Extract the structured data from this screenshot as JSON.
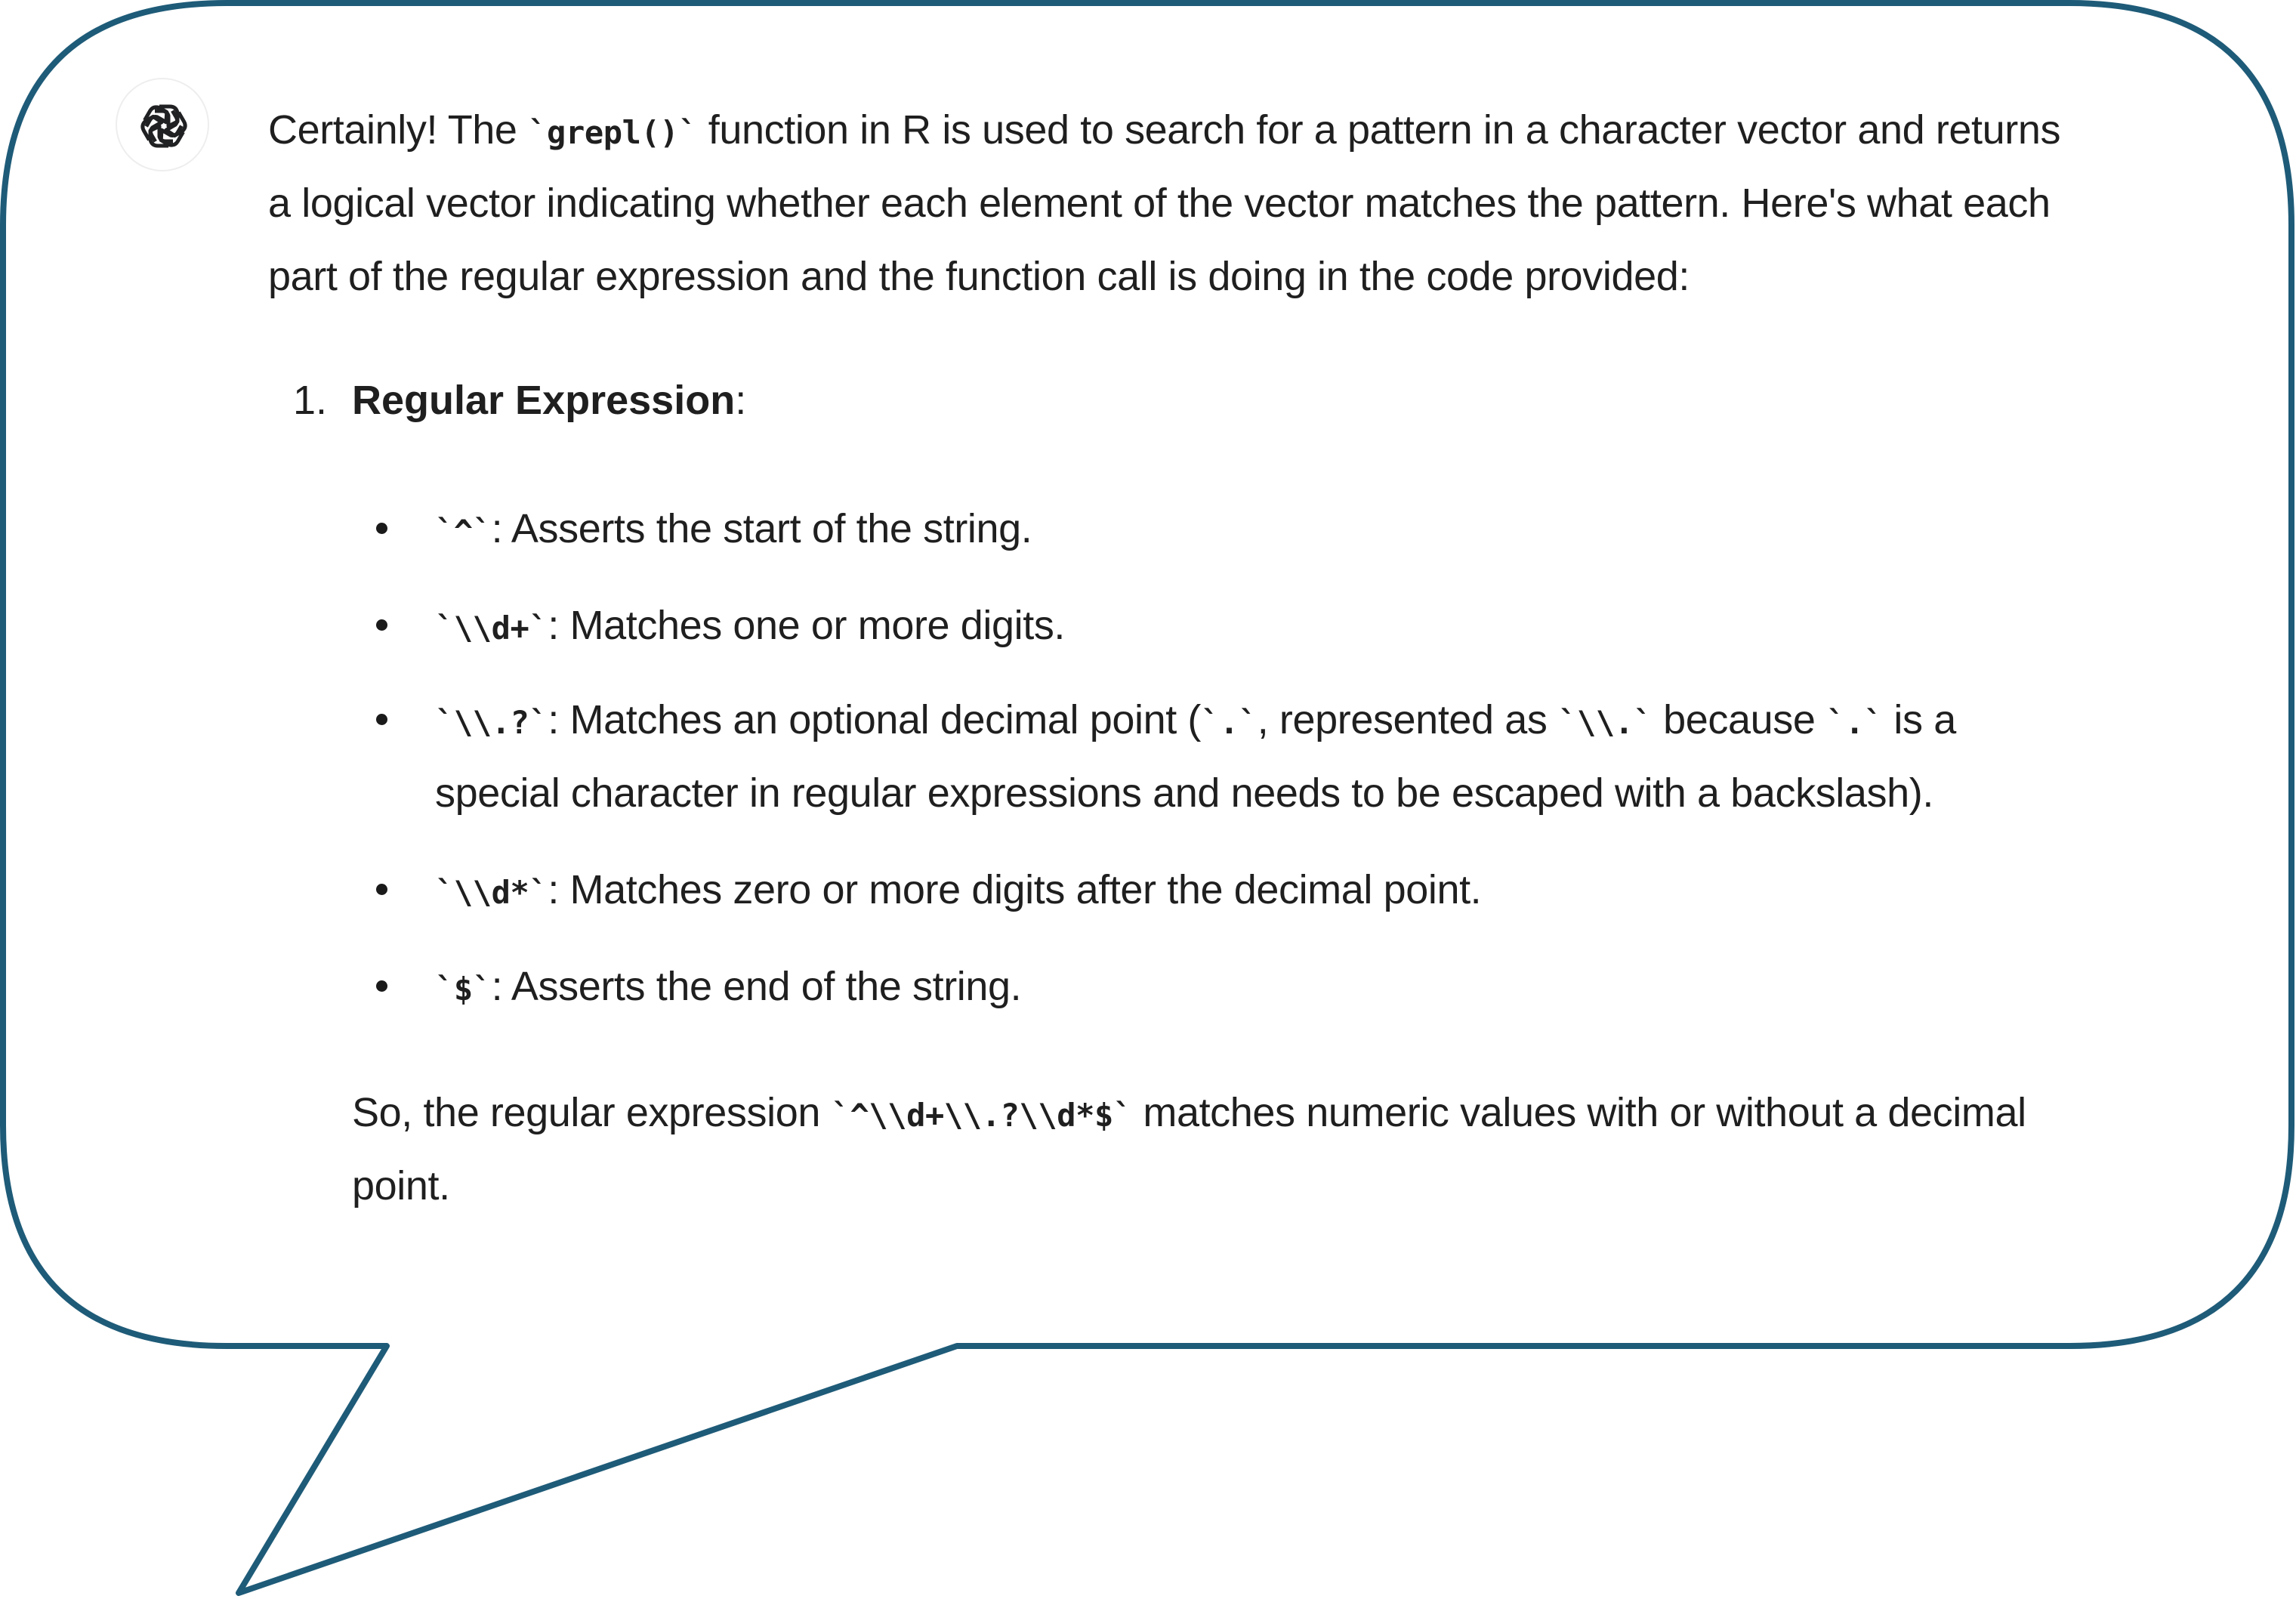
{
  "colors": {
    "bubble_stroke": "#1e5b78",
    "text": "#1f1f1f",
    "logo": "#202123"
  },
  "logo_icon": "openai-logo-icon",
  "intro": {
    "l1_a": "Certainly! The ",
    "l1_code": "`grepl()`",
    "l1_b": " function in R is used to search for a pattern in a character vector and returns",
    "l2": "a logical vector indicating whether each element of the vector matches the pattern. Here's what each",
    "l3": "part of the regular expression and the function call is doing in the code provided:"
  },
  "list": {
    "number": "1.",
    "heading": "Regular Expression",
    "heading_suffix": ":",
    "items": [
      {
        "code": "`^`",
        "text": ": Asserts the start of the string."
      },
      {
        "code": "`\\\\d+`",
        "text": ": Matches one or more digits."
      },
      {
        "code": "`\\\\.?`",
        "text_a": ": Matches an optional decimal point (",
        "code_b": "`.`",
        "text_b": ", represented as ",
        "code_c": "`\\\\.`",
        "text_c": " because ",
        "code_d": "`.`",
        "text_d": " is a",
        "line2": "special character in regular expressions and needs to be escaped with a backslash)."
      },
      {
        "code": "`\\\\d*`",
        "text": ": Matches zero or more digits after the decimal point."
      },
      {
        "code": "`$`",
        "text": ": Asserts the end of the string."
      }
    ]
  },
  "summary": {
    "a": "So, the regular expression ",
    "code": "`^\\\\d+\\\\.?\\\\d*$`",
    "b": " matches numeric values with or without a decimal",
    "line2": "point."
  }
}
